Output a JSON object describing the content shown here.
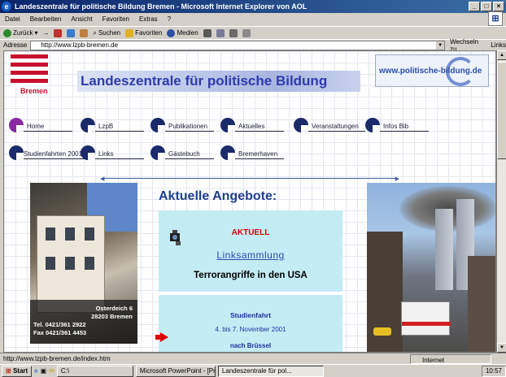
{
  "window": {
    "title": "Landeszentrale für politische Bildung Bremen - Microsoft Internet Explorer von AOL",
    "buttons": [
      "_",
      "□",
      "×"
    ]
  },
  "menubar": [
    "Datei",
    "Bearbeiten",
    "Ansicht",
    "Favoriten",
    "Extras",
    "?"
  ],
  "toolbar": {
    "back": "Zurück",
    "search": "Suchen",
    "favorites": "Favoriten",
    "media": "Medien"
  },
  "addressbar": {
    "label": "Adresse",
    "url": "http://www.lzpb-bremen.de",
    "go": "Wechseln zu",
    "links": "Links"
  },
  "page": {
    "logo_text": "Bremen",
    "banner": "Landeszentrale für politische Bildung",
    "pb_logo": "www.politische-bildung.de",
    "nav_row1": [
      "Home",
      "LzpB",
      "Publikationen",
      "Aktuelles",
      "Veranstaltungen",
      "Infos Bib"
    ],
    "nav_row2": [
      "Studienfahrten 2001",
      "Links",
      "Gästebuch",
      "Bremerhaven"
    ],
    "nav_colors": [
      "#8a2aa0",
      "#1a2a6a",
      "#1a2a6a",
      "#1a2a6a",
      "#1a2a6a",
      "#1a2a6a"
    ],
    "heading": "Aktuelle Angebote:",
    "aktuell": "AKTUELL",
    "linksammlung": "Linksammlung",
    "terror": "Terrorangriffe in den USA",
    "studienfahrt": "Studienfahrt",
    "date": "4. bis 7. November 2001",
    "bruessel": "nach Brüssel",
    "address": {
      "street": "Osterdeich 6",
      "city": "28203 Bremen",
      "tel": "Tel.  0421/361 2922",
      "fax": "Fax  0421/361 4453"
    }
  },
  "statusbar": {
    "url": "http://www.lzpb-bremen.de/index.htm",
    "zone": "Internet"
  },
  "taskbar": {
    "start": "Start",
    "tasks": [
      "C:\\",
      "Microsoft PowerPoint - [Pr...",
      "Landeszentrale für pol..."
    ],
    "clock": "10:57"
  }
}
